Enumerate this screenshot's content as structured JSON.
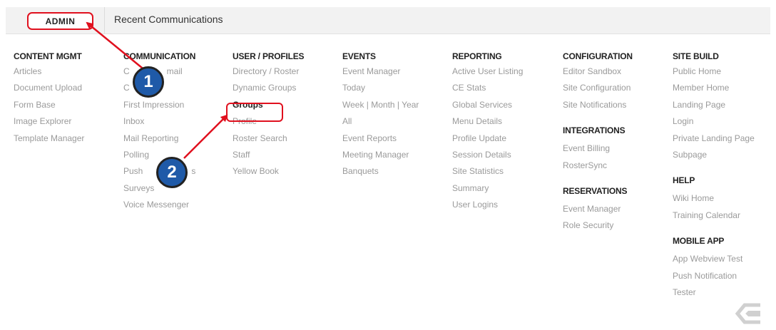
{
  "tabs": {
    "admin": "ADMIN",
    "recent": "Recent Communications"
  },
  "columns": [
    {
      "title": "CONTENT MGMT",
      "items": [
        "Articles",
        "Document Upload",
        "Form Base",
        "Image Explorer",
        "Template Manager"
      ]
    },
    {
      "title": "COMMUNICATION",
      "items": [
        "C",
        "C",
        "First Impression",
        "Inbox",
        "Mail Reporting",
        "Polling",
        "Push",
        "Surveys",
        "Voice Messenger"
      ]
    },
    {
      "title": "USER / PROFILES",
      "items": [
        "Directory / Roster",
        "Dynamic Groups",
        "Groups",
        "Profile",
        "Roster Search",
        "Staff",
        "Yellow Book"
      ]
    },
    {
      "title": "EVENTS",
      "items": [
        "Event Manager",
        "Today",
        "Week | Month | Year",
        "All",
        "Event Reports",
        "Meeting Manager",
        "Banquets"
      ]
    },
    {
      "title": "REPORTING",
      "items": [
        "Active User Listing",
        "CE Stats",
        "Global Services",
        "Menu Details",
        "Profile Update",
        "Session Details",
        "Site Statistics",
        "Summary",
        "User Logins"
      ]
    }
  ],
  "comm_partial": {
    "email_tail": "mail",
    "push_tail": "s"
  },
  "configuration": {
    "title": "CONFIGURATION",
    "items": [
      "Editor Sandbox",
      "Site Configuration",
      "Site Notifications"
    ]
  },
  "integrations": {
    "title": "INTEGRATIONS",
    "items": [
      "Event Billing",
      "RosterSync"
    ]
  },
  "reservations": {
    "title": "RESERVATIONS",
    "items": [
      "Event Manager",
      "Role Security"
    ]
  },
  "site_build": {
    "title": "SITE BUILD",
    "items": [
      "Public Home",
      "Member Home",
      "Landing Page",
      "Login",
      "Private Landing Page",
      "Subpage"
    ]
  },
  "help": {
    "title": "HELP",
    "items": [
      "Wiki Home",
      "Training Calendar"
    ]
  },
  "mobile_app": {
    "title": "MOBILE APP",
    "items": [
      "App Webview Test",
      "Push Notification",
      "Tester"
    ]
  },
  "badges": [
    "1",
    "2"
  ],
  "colors": {
    "callout": "#e0101e",
    "badge": "#1f5aa8"
  },
  "icons": [
    "logo-icon"
  ]
}
